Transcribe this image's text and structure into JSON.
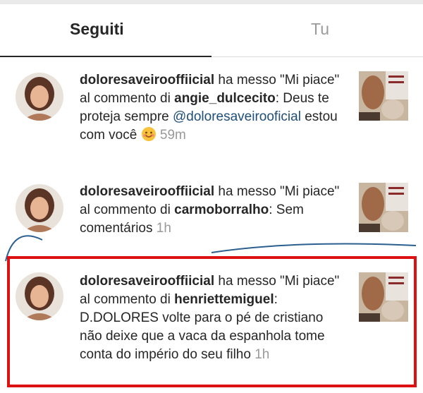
{
  "tabs": {
    "following": "Seguiti",
    "you": "Tu"
  },
  "notifications": [
    {
      "username": "doloresaveirooffiicial",
      "action_line": " ha messo \"Mi piace\" al commento di",
      "commenter": "angie_dulcecito",
      "comment_a": ": Deus te proteja sempre ",
      "mention": "@doloresaveirooficial",
      "comment_b": " estou com você ",
      "emoji": "smiling-face-emoji",
      "time": "59m"
    },
    {
      "username": "doloresaveirooffiicial",
      "action_line": " ha messo \"Mi piace\" al commento di",
      "commenter": "carmoborralho",
      "comment": ": Sem comentários ",
      "time": "1h"
    },
    {
      "username": "doloresaveirooffiicial",
      "action_line": " ha messo \"Mi piace\" al commento di",
      "commenter": "henriettemiguel",
      "comment": ": D.DOLORES volte para o pé de cristiano não deixe que a vaca da espanhola tome conta do império do seu filho ",
      "time": "1h"
    }
  ],
  "colors": {
    "highlight": "#dd1111",
    "mention": "#1f4e79",
    "timestamp": "#999999"
  }
}
